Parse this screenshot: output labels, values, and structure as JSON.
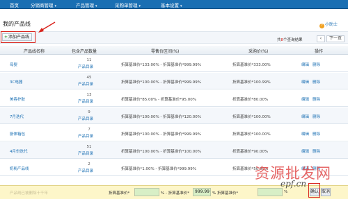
{
  "nav": {
    "items": [
      {
        "label": "首页",
        "caret": ""
      },
      {
        "label": "分销商管理",
        "caret": "▾"
      },
      {
        "label": "产品管理",
        "caret": "▾"
      },
      {
        "label": "采购单管理",
        "caret": "▾"
      },
      {
        "label": "基本设置",
        "caret": "▾"
      }
    ]
  },
  "page": {
    "title": "我的产品线",
    "help": "小助士",
    "add_button": "添加产品线"
  },
  "pager": {
    "total_prefix": "共",
    "total_count": "8",
    "total_suffix": "个查询结果",
    "prev": "‹",
    "next": "下一页"
  },
  "table": {
    "headers": [
      "产品线名称",
      "包含产品数量",
      "零售价区间(%)",
      "采购价(%)",
      "操作"
    ],
    "catalog_label": "产品目录",
    "edit_label": "编辑",
    "delete_label": "删除",
    "rows": [
      {
        "name": "母婴",
        "count": "11",
        "retail": "折算基准价*133.00% - 折算基准价*999.99%",
        "purchase": "折算基准价*333.00%"
      },
      {
        "name": "3C电器",
        "count": "45",
        "retail": "折算基准价*100.00% - 折算基准价*999.99%",
        "purchase": "折算基准价*100.99%"
      },
      {
        "name": "美容护肤",
        "count": "13",
        "retail": "折算基准价*85.00% - 折算基准价*95.00%",
        "purchase": "折算基准价*80.00%"
      },
      {
        "name": "7月迭代",
        "count": "9",
        "retail": "折算基准价*100.00% - 折算基准价*120.00%",
        "purchase": "折算基准价*100.00%"
      },
      {
        "name": "厨体箱包",
        "count": "7",
        "retail": "折算基准价*100.00% - 折算基准价*999.99%",
        "purchase": "折算基准价*100.00%"
      },
      {
        "name": "4月份迭代",
        "count": "51",
        "retail": "折算基准价*100.00% - 折算基准价*100.00%",
        "purchase": "折算基准价*90.00%"
      },
      {
        "name": "奶粉产品线",
        "count": "2",
        "retail": "折算基准价*1.00% - 折算基准价*999.99%",
        "purchase": "折算基准价*50.00%"
      }
    ]
  },
  "bottom": {
    "placeholder_label": "产品线已被删除十千年",
    "label1": "折算基准价*",
    "input1": "",
    "pct1": "% - 折算基准价*",
    "input2": "999.99",
    "pct2": "% 折算基准价*",
    "input3": "",
    "pct3": "%",
    "save": "确认",
    "cancel": "取消"
  },
  "watermark": {
    "text": "资源批发网",
    "url": "epf.cn"
  }
}
